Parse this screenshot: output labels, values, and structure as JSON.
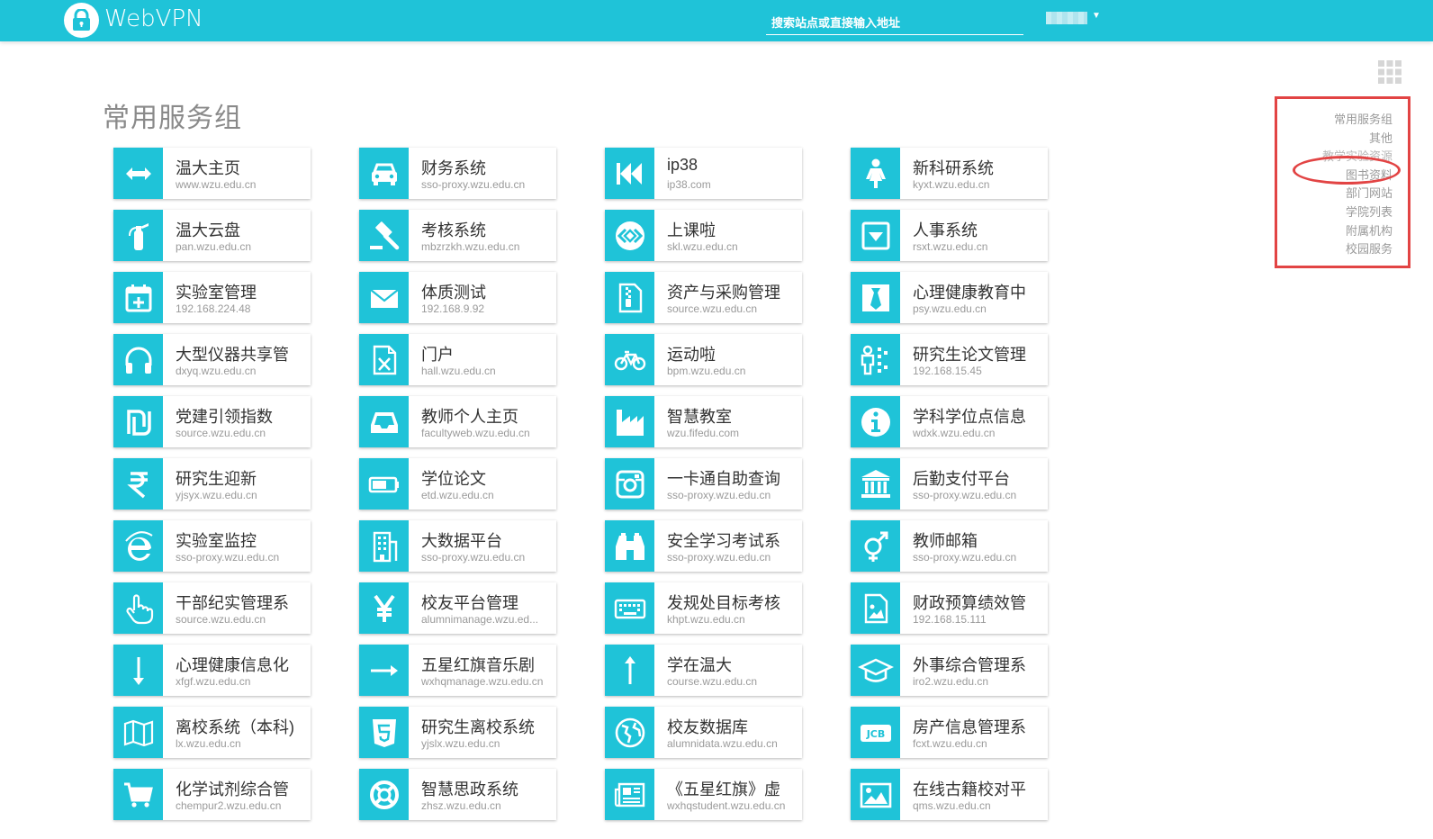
{
  "header": {
    "brand": "WebVPN",
    "search_placeholder": "搜索站点或直接输入地址",
    "accent_color": "#1fc3d8"
  },
  "page_title": "常用服务组",
  "side_nav": [
    "常用服务组",
    "其他",
    "教学实验资源",
    "图书资料",
    "部门网站",
    "学院列表",
    "附属机构",
    "校园服务"
  ],
  "annotation_color": "#e24444",
  "columns": [
    [
      {
        "name": "温大主页",
        "url": "www.wzu.edu.cn",
        "icon": "arrows-h-icon"
      },
      {
        "name": "温大云盘",
        "url": "pan.wzu.edu.cn",
        "icon": "fire-extinguisher-icon"
      },
      {
        "name": "实验室管理",
        "url": "192.168.224.48",
        "icon": "calendar-plus-icon"
      },
      {
        "name": "大型仪器共享管",
        "url": "dxyq.wzu.edu.cn",
        "icon": "headphones-icon"
      },
      {
        "name": "党建引领指数",
        "url": "source.wzu.edu.cn",
        "icon": "shekel-icon"
      },
      {
        "name": "研究生迎新",
        "url": "yjsyx.wzu.edu.cn",
        "icon": "rupee-icon"
      },
      {
        "name": "实验室监控",
        "url": "sso-proxy.wzu.edu.cn",
        "icon": "internet-explorer-icon"
      },
      {
        "name": "干部纪实管理系",
        "url": "source.wzu.edu.cn",
        "icon": "hand-pointer-icon"
      },
      {
        "name": "心理健康信息化",
        "url": "xfgf.wzu.edu.cn",
        "icon": "long-arrow-down-icon"
      },
      {
        "name": "离校系统（本科)",
        "url": "lx.wzu.edu.cn",
        "icon": "map-icon"
      },
      {
        "name": "化学试剂综合管",
        "url": "chempur2.wzu.edu.cn",
        "icon": "shopping-cart-icon"
      }
    ],
    [
      {
        "name": "财务系统",
        "url": "sso-proxy.wzu.edu.cn",
        "icon": "car-icon"
      },
      {
        "name": "考核系统",
        "url": "mbzrzkh.wzu.edu.cn",
        "icon": "gavel-icon"
      },
      {
        "name": "体质测试",
        "url": "192.168.9.92",
        "icon": "envelope-icon"
      },
      {
        "name": "门户",
        "url": "hall.wzu.edu.cn",
        "icon": "file-excel-icon"
      },
      {
        "name": "教师个人主页",
        "url": "facultyweb.wzu.edu.cn",
        "icon": "inbox-icon"
      },
      {
        "name": "学位论文",
        "url": "etd.wzu.edu.cn",
        "icon": "battery-icon"
      },
      {
        "name": "大数据平台",
        "url": "sso-proxy.wzu.edu.cn",
        "icon": "building-icon"
      },
      {
        "name": "校友平台管理",
        "url": "alumnimanage.wzu.ed...",
        "icon": "yen-icon"
      },
      {
        "name": "五星红旗音乐剧",
        "url": "wxhqmanage.wzu.edu.cn",
        "icon": "long-arrow-right-icon"
      },
      {
        "name": "研究生离校系统",
        "url": "yjslx.wzu.edu.cn",
        "icon": "html5-icon"
      },
      {
        "name": "智慧思政系统",
        "url": "zhsz.wzu.edu.cn",
        "icon": "life-ring-icon"
      }
    ],
    [
      {
        "name": "ip38",
        "url": "ip38.com",
        "icon": "fast-backward-icon"
      },
      {
        "name": "上课啦",
        "url": "skl.wzu.edu.cn",
        "icon": "code-circle-icon"
      },
      {
        "name": "资产与采购管理",
        "url": "source.wzu.edu.cn",
        "icon": "file-archive-icon"
      },
      {
        "name": "运动啦",
        "url": "bpm.wzu.edu.cn",
        "icon": "bicycle-icon"
      },
      {
        "name": "智慧教室",
        "url": "wzu.fifedu.com",
        "icon": "industry-icon"
      },
      {
        "name": "一卡通自助查询",
        "url": "sso-proxy.wzu.edu.cn",
        "icon": "instagram-icon"
      },
      {
        "name": "安全学习考试系",
        "url": "sso-proxy.wzu.edu.cn",
        "icon": "binoculars-icon"
      },
      {
        "name": "发规处目标考核",
        "url": "khpt.wzu.edu.cn",
        "icon": "keyboard-icon"
      },
      {
        "name": "学在温大",
        "url": "course.wzu.edu.cn",
        "icon": "long-arrow-up-icon"
      },
      {
        "name": "校友数据库",
        "url": "alumnidata.wzu.edu.cn",
        "icon": "globe-icon"
      },
      {
        "name": "《五星红旗》虚",
        "url": "wxhqstudent.wzu.edu.cn",
        "icon": "newspaper-icon"
      }
    ],
    [
      {
        "name": "新科研系统",
        "url": "kyxt.wzu.edu.cn",
        "icon": "female-icon"
      },
      {
        "name": "人事系统",
        "url": "rsxt.wzu.edu.cn",
        "icon": "caret-square-down-icon"
      },
      {
        "name": "心理健康教育中",
        "url": "psy.wzu.edu.cn",
        "icon": "black-tie-icon"
      },
      {
        "name": "研究生论文管理",
        "url": "192.168.15.45",
        "icon": "odnoklassniki-icon"
      },
      {
        "name": "学科学位点信息",
        "url": "wdxk.wzu.edu.cn",
        "icon": "info-circle-icon"
      },
      {
        "name": "后勤支付平台",
        "url": "sso-proxy.wzu.edu.cn",
        "icon": "university-icon"
      },
      {
        "name": "教师邮箱",
        "url": "sso-proxy.wzu.edu.cn",
        "icon": "transgender-icon"
      },
      {
        "name": "财政预算绩效管",
        "url": "192.168.15.111",
        "icon": "file-image-icon"
      },
      {
        "name": "外事综合管理系",
        "url": "iro2.wzu.edu.cn",
        "icon": "graduation-cap-icon"
      },
      {
        "name": "房产信息管理系",
        "url": "fcxt.wzu.edu.cn",
        "icon": "cc-jcb-icon"
      },
      {
        "name": "在线古籍校对平",
        "url": "qms.wzu.edu.cn",
        "icon": "image-icon"
      }
    ]
  ]
}
